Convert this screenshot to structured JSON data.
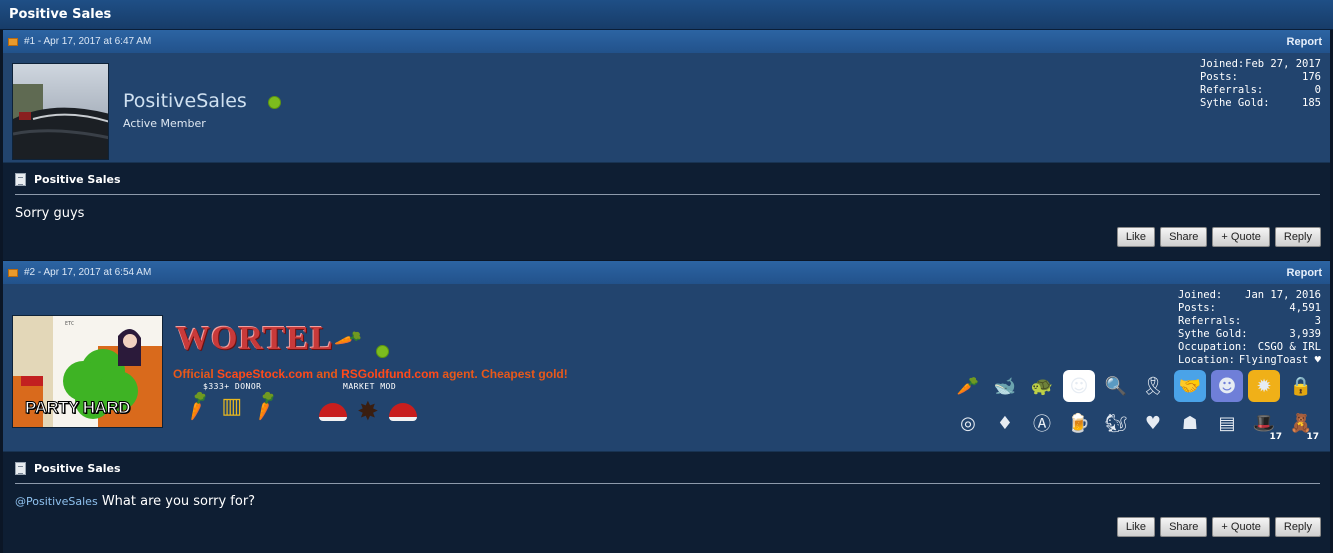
{
  "thread": {
    "title": "Positive Sales"
  },
  "posts": [
    {
      "meta": "#1 - Apr 17, 2017 at 6:47 AM",
      "report_label": "Report",
      "username": "PositiveSales",
      "user_title": "Active Member",
      "stats": [
        {
          "label": "Joined:",
          "value": "Feb 27, 2017"
        },
        {
          "label": "Posts:",
          "value": "176"
        },
        {
          "label": "Referrals:",
          "value": "0"
        },
        {
          "label": "Sythe Gold:",
          "value": "185"
        }
      ],
      "message_title": "Positive Sales",
      "message_text": "Sorry guys",
      "buttons": {
        "like": "Like",
        "share": "Share",
        "quote": "+ Quote",
        "reply": "Reply"
      }
    },
    {
      "meta": "#2 - Apr 17, 2017 at 6:54 AM",
      "report_label": "Report",
      "avatar_caption": "PARTY HARD",
      "username": "WORTEL",
      "signature": {
        "prefix": "Official ",
        "brand1": "ScapeStock.com",
        "middle": " and ",
        "brand2": "RSGoldfund.com",
        "suffix": " agent. Cheapest gold!",
        "badge1": "$333+ DONOR",
        "badge2": "MARKET MOD"
      },
      "stats": [
        {
          "label": "Joined:",
          "value": "Jan 17, 2016"
        },
        {
          "label": "Posts:",
          "value": "4,591"
        },
        {
          "label": "Referrals:",
          "value": "3"
        },
        {
          "label": "Sythe Gold:",
          "value": "3,939"
        },
        {
          "label": "Occupation:",
          "value": "CSGO & IRL"
        },
        {
          "label": "Location:",
          "value": "FlyingToast ♥"
        }
      ],
      "trophies_row1": [
        {
          "icon": "carrot-icon",
          "glyph": "🥕",
          "bg": "transparent"
        },
        {
          "icon": "whale-icon",
          "glyph": "🐋",
          "bg": "transparent"
        },
        {
          "icon": "blastoise-icon",
          "glyph": "🐢",
          "bg": "transparent"
        },
        {
          "icon": "anonymous-mask-icon",
          "glyph": "☺",
          "bg": "#ffffff"
        },
        {
          "icon": "magnifier-icon",
          "glyph": "🔍",
          "bg": "transparent"
        },
        {
          "icon": "ribbon-icon",
          "glyph": "🎗",
          "bg": "transparent"
        },
        {
          "icon": "handshake-icon",
          "glyph": "🤝",
          "bg": "#4aa3e8"
        },
        {
          "icon": "discord-icon",
          "glyph": "☻",
          "bg": "#6f7fd8"
        },
        {
          "icon": "gold-badge-icon",
          "glyph": "✹",
          "bg": "#f0b018"
        },
        {
          "icon": "lock-icon",
          "glyph": "🔒",
          "bg": "transparent"
        }
      ],
      "trophies_row2": [
        {
          "icon": "rio-2016-icon",
          "glyph": "◎",
          "bg": "transparent",
          "count": ""
        },
        {
          "icon": "red-ribbon-icon",
          "glyph": "♦",
          "bg": "transparent",
          "count": ""
        },
        {
          "icon": "anarchy-icon",
          "glyph": "Ⓐ",
          "bg": "transparent",
          "count": ""
        },
        {
          "icon": "beer-mug-icon",
          "glyph": "🍺",
          "bg": "transparent",
          "count": ""
        },
        {
          "icon": "squirrel-icon",
          "glyph": "🐿",
          "bg": "transparent",
          "count": ""
        },
        {
          "icon": "heart-n4n0-icon",
          "glyph": "♥",
          "bg": "transparent",
          "count": ""
        },
        {
          "icon": "vader-icon",
          "glyph": "☗",
          "bg": "transparent",
          "count": ""
        },
        {
          "icon": "gold-stack-icon",
          "glyph": "▤",
          "bg": "transparent",
          "count": ""
        },
        {
          "icon": "green-hat-icon",
          "glyph": "🎩",
          "bg": "transparent",
          "count": "17"
        },
        {
          "icon": "teddy-bear-icon",
          "glyph": "🧸",
          "bg": "transparent",
          "count": "17"
        }
      ],
      "message_title": "Positive Sales",
      "mention": "@PositiveSales",
      "message_text": " What are you sorry for?",
      "buttons": {
        "like": "Like",
        "share": "Share",
        "quote": "+ Quote",
        "reply": "Reply"
      }
    }
  ]
}
